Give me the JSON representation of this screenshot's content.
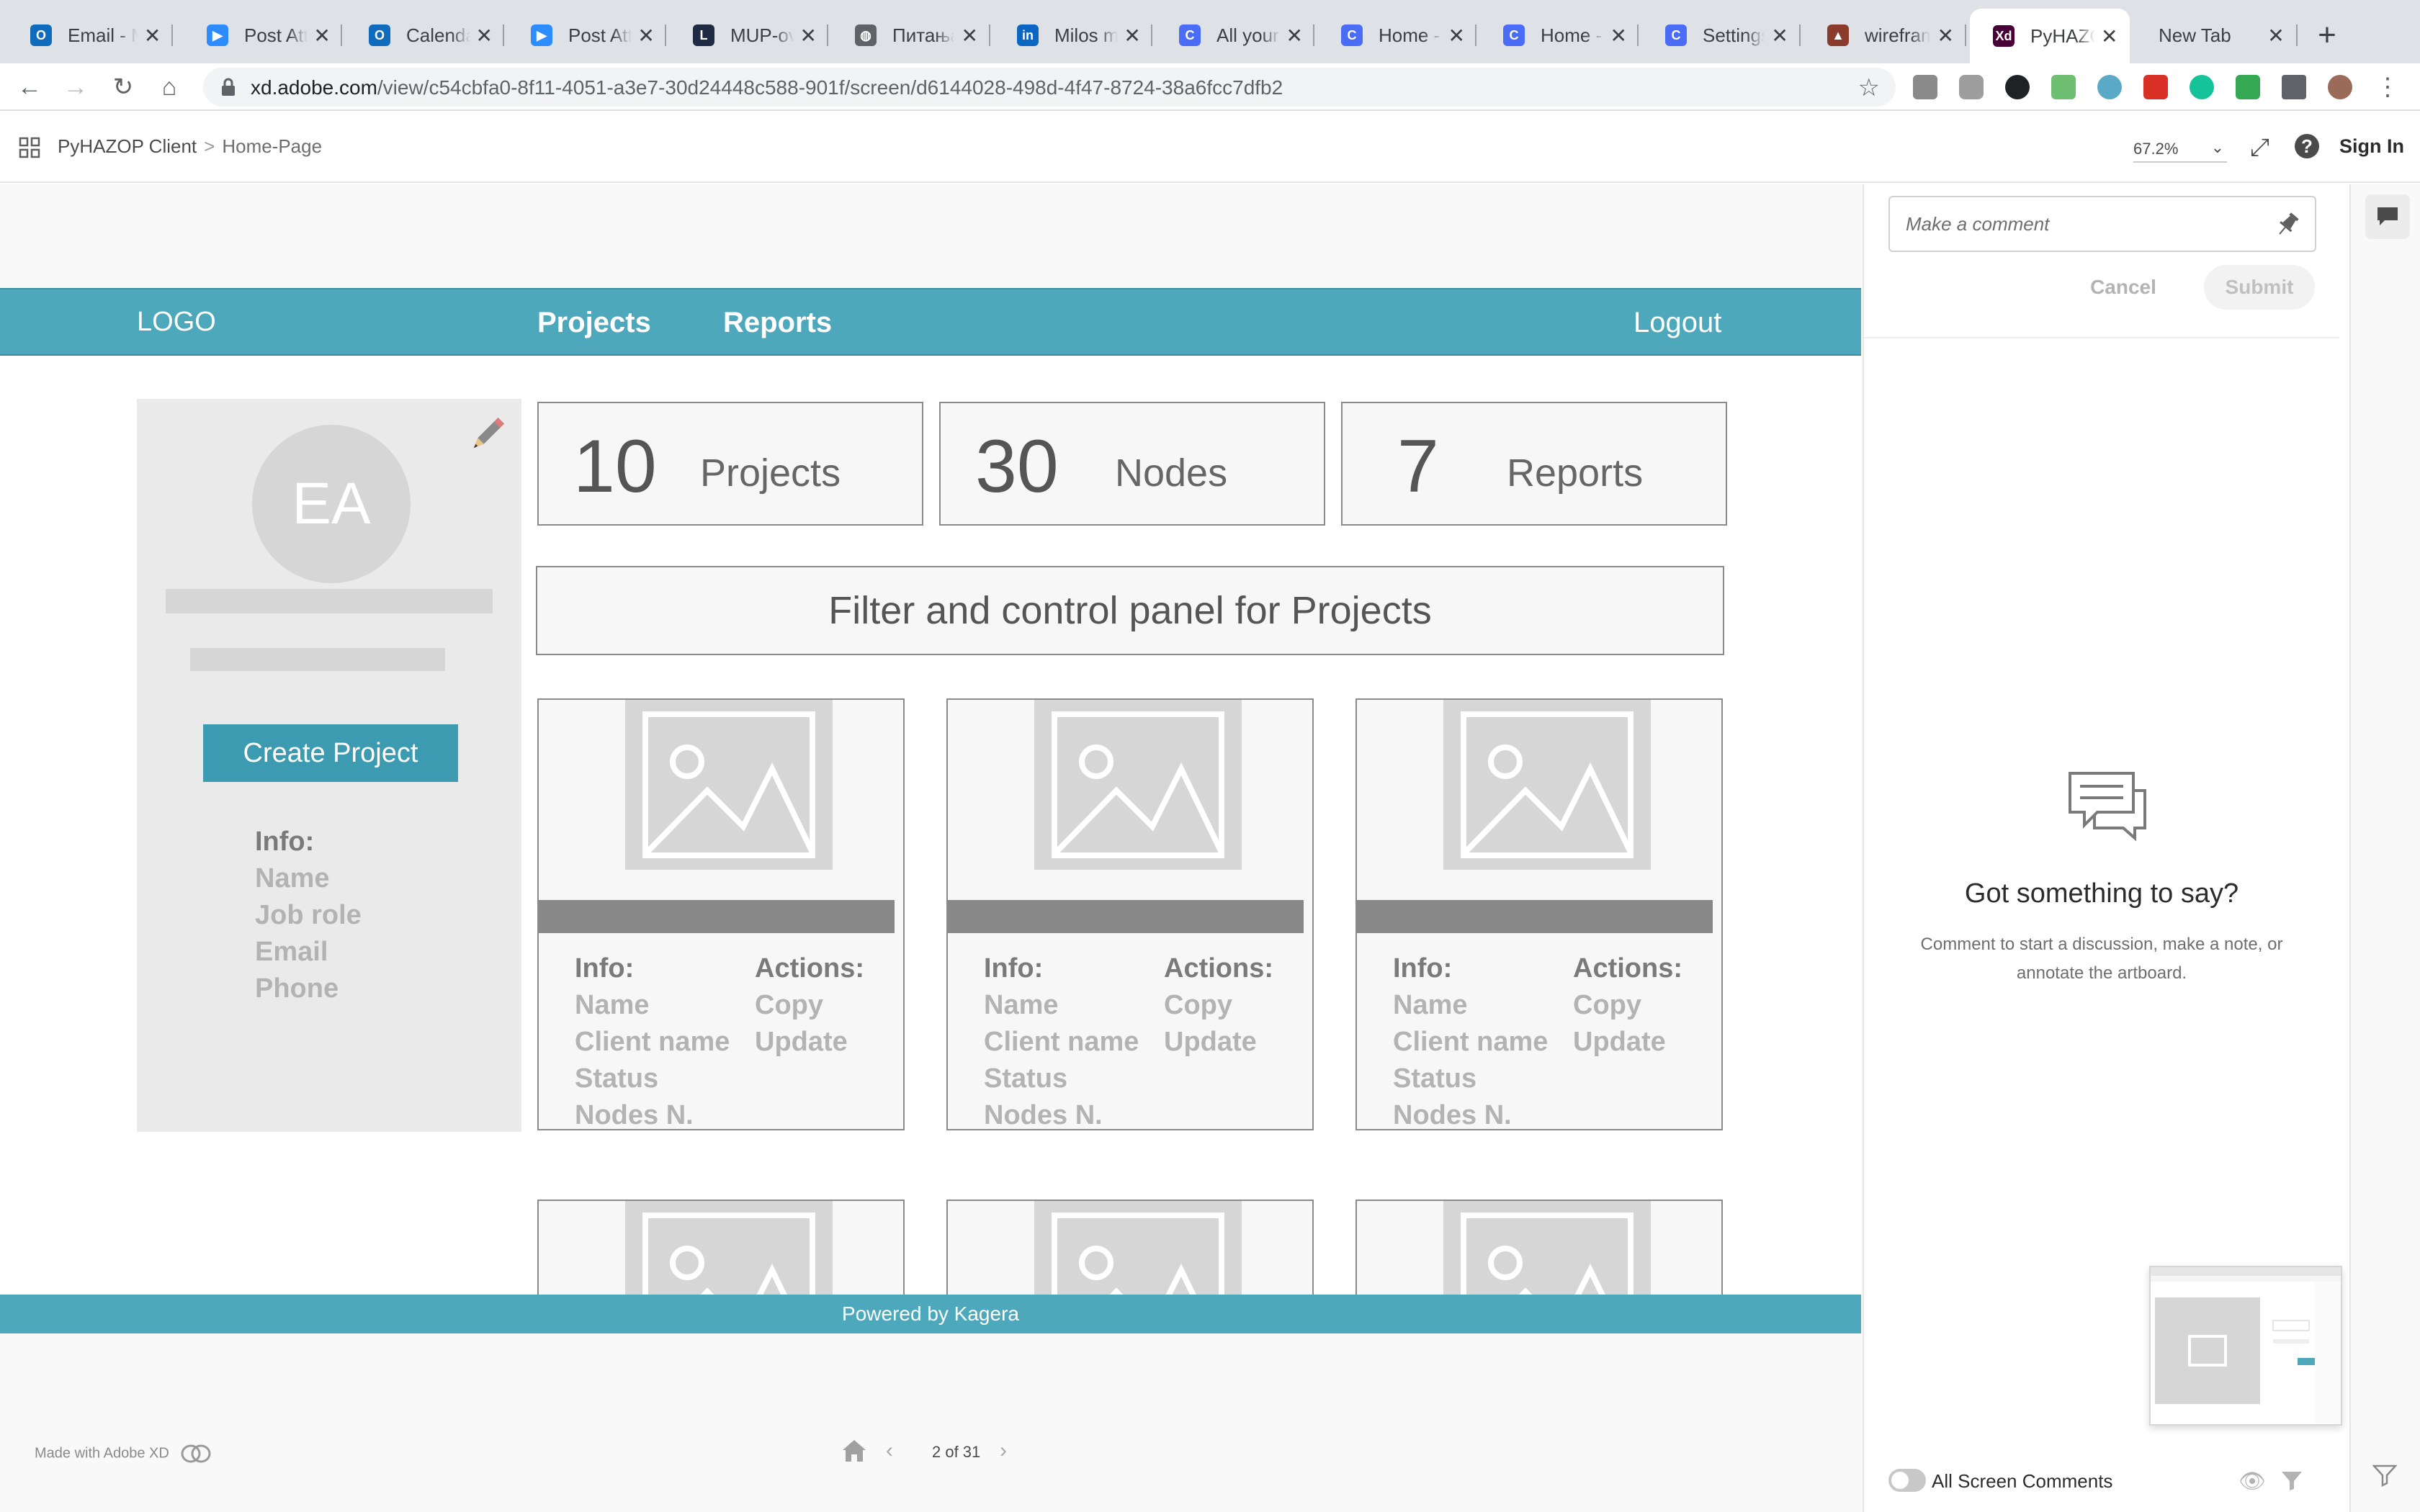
{
  "browser": {
    "tabs": [
      {
        "title": "Email - M",
        "color": "#0f6cbd",
        "glyph": "O"
      },
      {
        "title": "Post Atte",
        "color": "#2d8cff",
        "glyph": "▶"
      },
      {
        "title": "Calendar",
        "color": "#0f6cbd",
        "glyph": "O"
      },
      {
        "title": "Post Atte",
        "color": "#2d8cff",
        "glyph": "▶"
      },
      {
        "title": "MUP-ova",
        "color": "#1f2a44",
        "glyph": "L"
      },
      {
        "title": "Питања",
        "color": "#5f6368",
        "glyph": "◍"
      },
      {
        "title": "Milos me",
        "color": "#0a66c2",
        "glyph": "in"
      },
      {
        "title": "All your c",
        "color": "#4a6cf7",
        "glyph": "C"
      },
      {
        "title": "Home - C",
        "color": "#4a6cf7",
        "glyph": "C"
      },
      {
        "title": "Home - C",
        "color": "#4a6cf7",
        "glyph": "C"
      },
      {
        "title": "Settings",
        "color": "#4a6cf7",
        "glyph": "C"
      },
      {
        "title": "wirefram",
        "color": "#8a3b2b",
        "glyph": "▲"
      },
      {
        "title": "PyHAZO",
        "color": "#470137",
        "glyph": "Xd",
        "active": true
      },
      {
        "title": "New Tab",
        "color": "",
        "glyph": ""
      }
    ],
    "close_glyph": "✕",
    "new_tab_glyph": "+",
    "url_host": "xd.adobe.com",
    "url_path": "/view/c54cbfa0-8f11-4051-a3e7-30d24448c588-901f/screen/d6144028-498d-4f47-8724-38a6fcc7dfb2",
    "nav_back": "←",
    "nav_forward": "→",
    "nav_reload": "↻",
    "nav_home": "⌂",
    "star": "☆",
    "menu": "⋮"
  },
  "xd_header": {
    "app_name": "PyHAZOP Client",
    "separator": ">",
    "page_name": "Home-Page",
    "zoom": "67.2%",
    "help": "?",
    "sign_in": "Sign In"
  },
  "app": {
    "logo": "LOGO",
    "nav": [
      "Projects",
      "Reports"
    ],
    "logout": "Logout",
    "profile": {
      "initials": "EA",
      "create_button": "Create Project",
      "info_heading": "Info:",
      "info_items": [
        "Name",
        "Job role",
        "Email",
        "Phone"
      ]
    },
    "stats": [
      {
        "value": "10",
        "label": "Projects"
      },
      {
        "value": "30",
        "label": "Nodes"
      },
      {
        "value": "7",
        "label": "Reports"
      }
    ],
    "filter_panel": "Filter and control panel for Projects",
    "card": {
      "info_heading": "Info:",
      "info_items": [
        "Name",
        "Client name",
        "Status",
        "Nodes N."
      ],
      "actions_heading": "Actions:",
      "actions": [
        "Copy",
        "Update"
      ]
    },
    "footer": "Powered by Kagera"
  },
  "xd_footer": {
    "made_with": "Made with Adobe XD",
    "page_counter": "2 of 31",
    "prev": "‹",
    "next": "›"
  },
  "comments": {
    "placeholder": "Make a comment",
    "cancel": "Cancel",
    "submit": "Submit",
    "empty_title": "Got something to say?",
    "empty_text": "Comment to start a discussion, make a note, or annotate the artboard.",
    "all_screen": "All Screen Comments"
  },
  "colors": {
    "brand_teal": "#4da8bc",
    "button_teal": "#3c9bb0",
    "placeholder_gray": "#d6d6d6"
  }
}
